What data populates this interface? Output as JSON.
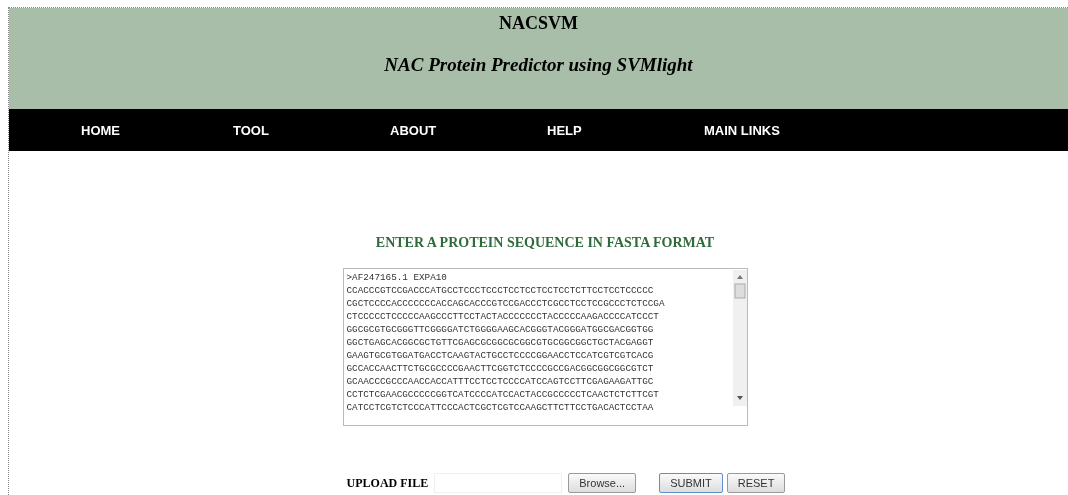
{
  "header": {
    "title": "NACSVM",
    "subtitle": "NAC Protein Predictor using SVMlight"
  },
  "nav": [
    {
      "label": "HOME"
    },
    {
      "label": "TOOL"
    },
    {
      "label": "ABOUT"
    },
    {
      "label": "HELP"
    },
    {
      "label": "MAIN LINKS"
    }
  ],
  "form": {
    "heading": "ENTER A PROTEIN SEQUENCE IN FASTA FORMAT",
    "sequence": ">AF247165.1 EXPA10\nCCACCCGTCCGACCCATGCCTCCCTCCCTCCTCCTCCTCCTCTTCCTCCTCCCCC\nCGCTCCCCACCCCCCCACCAGCACCCGTCCGACCCTCGCCTCCTCCGCCCTCTCCGA\nCTCCCCCTCCCCCAAGCCCTTCCTACTACCCCCCCTACCCCCAAGACCCCATCCCT\nGGCGCGTGCGGGTTCGGGGATCTGGGGAAGCACGGGTACGGGATGGCGACGGTGG\nGGCTGAGCACGGCGCTGTTCGAGCGCGGCGCGGCGTGCGGCGGCTGCTACGAGGT\nGAAGTGCGTGGATGACCTCAAGTACTGCCTCCCCGGAACCTCCATCGTCGTCACG\nGCCACCAACTTCTGCGCCCCGAACTTCGGTCTCCCCGCCGACGGCGGCGGCGTCT\nGCAACCCGCCCAACCACCATTTCCTCCTCCCCATCCAGTCCTTCGAGAAGATTGC\nCCTCTCGAACGCCCCCGGTCATCCCCATCCACTACCGCCCCCTCAACTCTCTTCGT\nCATCCTCGTCTCCCATTCCCACTCGCTCGTCCAAGCTTCTTCCTGACACTCCTAA",
    "upload_label": "UPLOAD FILE",
    "browse": "Browse...",
    "submit": "SUBMIT",
    "reset": "RESET"
  }
}
